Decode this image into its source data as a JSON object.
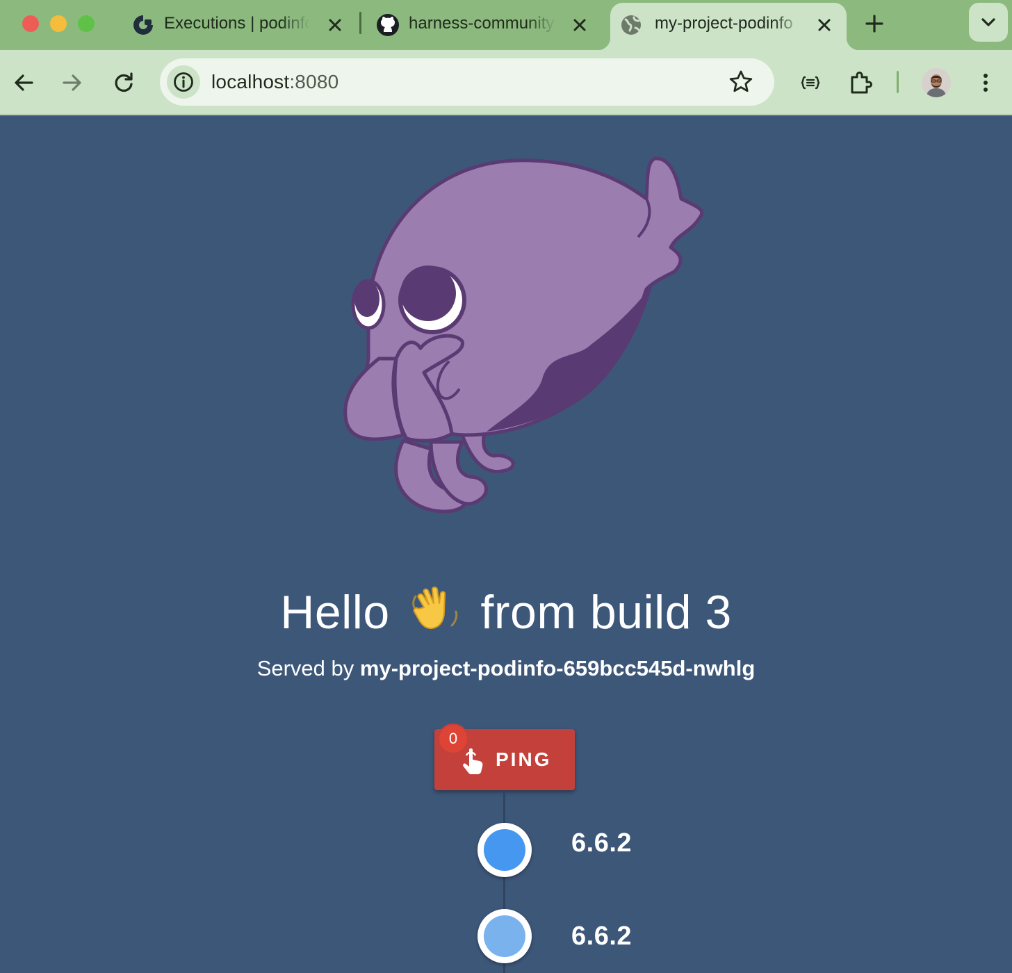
{
  "browser": {
    "tabs": [
      {
        "title": "Executions | podinfo",
        "icon": "harness-icon",
        "active": false
      },
      {
        "title": "harness-community",
        "icon": "github-icon",
        "active": false
      },
      {
        "title": "my-project-podinfo",
        "icon": "globe-icon",
        "active": true
      }
    ],
    "address_bar": {
      "host": "localhost",
      "port": ":8080"
    }
  },
  "page": {
    "headline_prefix": "Hello",
    "headline_emoji": "waving-hand-icon",
    "headline_suffix": "from build 3",
    "served_prefix": "Served by",
    "served_host": "my-project-podinfo-659bcc545d-nwhlg",
    "ping": {
      "label": "PING",
      "count": "0"
    },
    "timeline": [
      {
        "version": "6.6.2",
        "color": "#4597f0"
      },
      {
        "version": "6.6.2",
        "color": "#7ab2ee"
      }
    ]
  },
  "colors": {
    "page_background": "#3d5779",
    "ping_button": "#c4403a",
    "tab_strip": "#8cba7e",
    "toolbar": "#cde3c7"
  }
}
